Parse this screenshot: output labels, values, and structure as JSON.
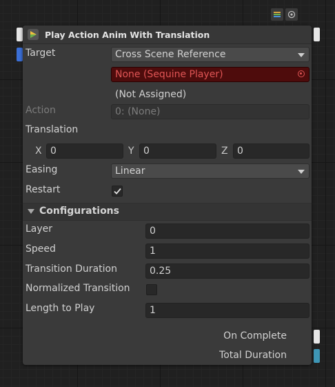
{
  "node": {
    "title": "Play Action Anim With Translation",
    "fields": {
      "target": {
        "label": "Target",
        "value": "Cross Scene Reference"
      },
      "reference": {
        "value": "None (Sequine Player)",
        "note": "(Not Assigned)"
      },
      "action": {
        "label": "Action",
        "value": "0: (None)"
      },
      "translation": {
        "label": "Translation",
        "x_label": "X",
        "x": "0",
        "y_label": "Y",
        "y": "0",
        "z_label": "Z",
        "z": "0"
      },
      "easing": {
        "label": "Easing",
        "value": "Linear"
      },
      "restart": {
        "label": "Restart",
        "checked": true
      }
    },
    "configurations": {
      "title": "Configurations",
      "layer": {
        "label": "Layer",
        "value": "0"
      },
      "speed": {
        "label": "Speed",
        "value": "1"
      },
      "transition_duration": {
        "label": "Transition Duration",
        "value": "0.25"
      },
      "normalized_transition": {
        "label": "Normalized Transition",
        "checked": false
      },
      "length_to_play": {
        "label": "Length to Play",
        "value": "1"
      }
    },
    "outputs": {
      "on_complete": "On Complete",
      "total_duration": "Total Duration"
    }
  },
  "colors": {
    "error": "#e05555",
    "flow_port": "#e6e6e6",
    "input_port": "#3b6fd6",
    "float_port": "#3e96b6"
  }
}
